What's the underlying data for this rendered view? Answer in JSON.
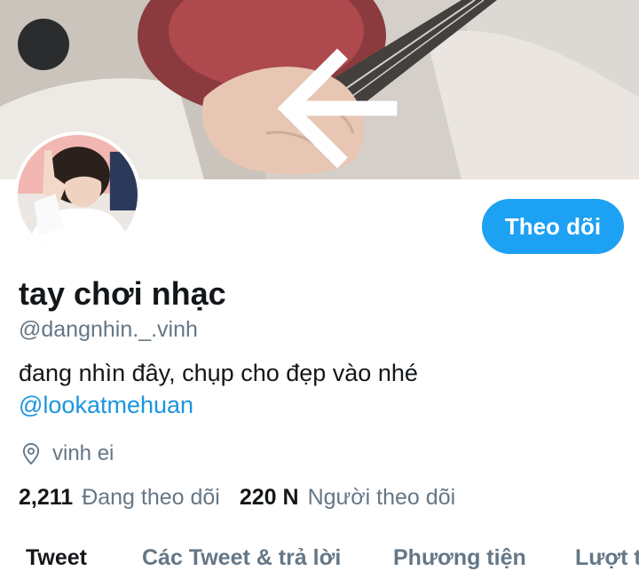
{
  "profile": {
    "display_name": "tay chơi nhạc",
    "handle": "@dangnhin._.vinh",
    "bio_text": "đang nhìn đây, chụp cho đẹp vào nhé",
    "bio_mention": "@lookatmehuan",
    "location": "vinh ei",
    "follow_label": "Theo dõi"
  },
  "stats": {
    "following_value": "2,211",
    "following_label": "Đang theo dõi",
    "followers_value": "220 N",
    "followers_label": "Người theo dõi"
  },
  "tabs": [
    {
      "label": "Tweet",
      "active": true
    },
    {
      "label": "Các Tweet & trả lời",
      "active": false
    },
    {
      "label": "Phương tiện",
      "active": false
    },
    {
      "label": "Lượt thích",
      "active": false
    }
  ],
  "icons": {
    "back": "arrow-left-icon",
    "location": "location-pin-icon"
  },
  "colors": {
    "accent": "#1da1f2",
    "mention": "#1b95e0",
    "muted": "#657786",
    "text": "#14171a"
  }
}
